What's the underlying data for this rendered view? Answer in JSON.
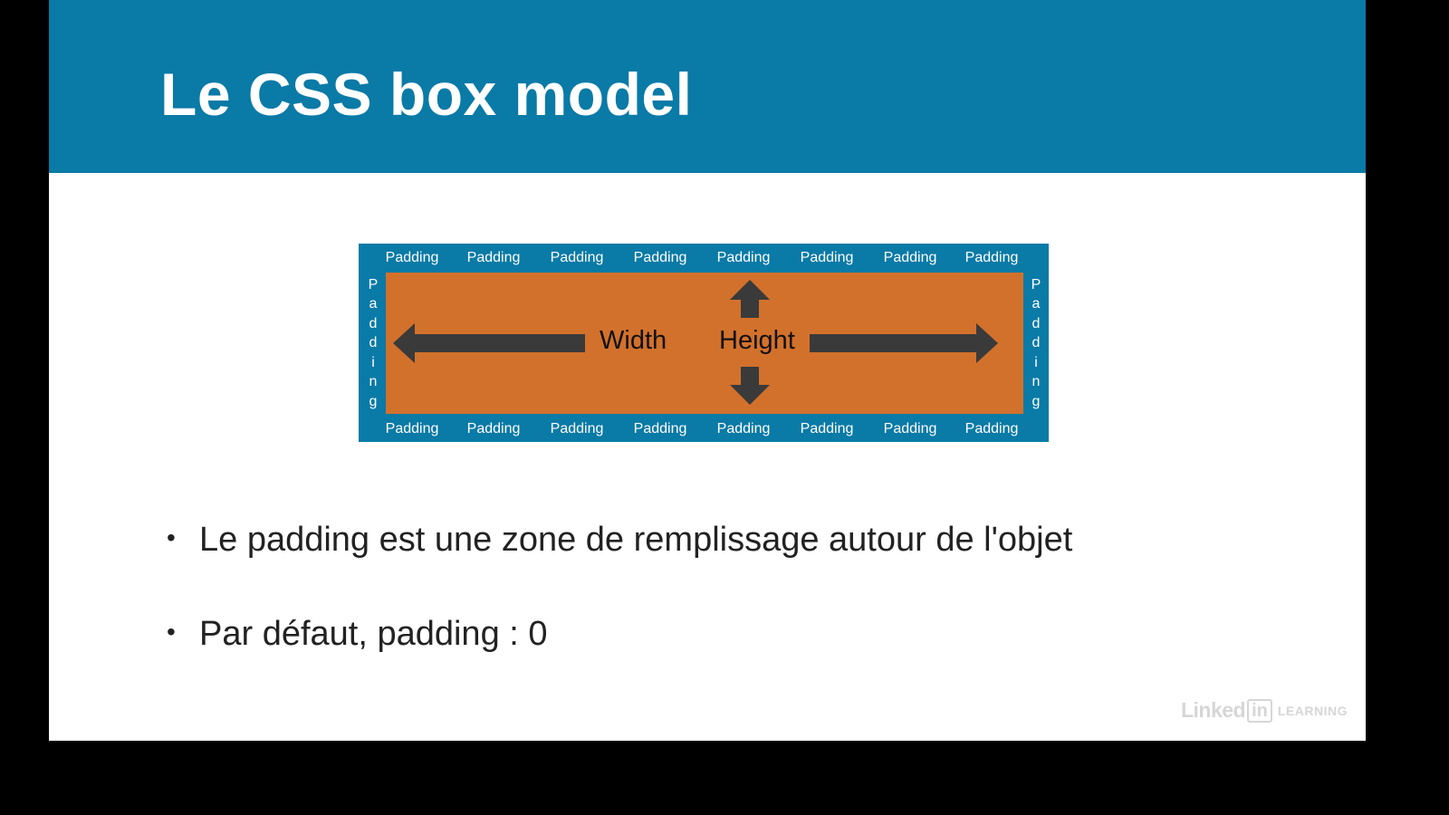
{
  "slide": {
    "title": "Le CSS box model",
    "diagram": {
      "padding_label": "Padding",
      "vertical_padding_letters": [
        "P",
        "a",
        "d",
        "d",
        "i",
        "n",
        "g"
      ],
      "width_label": "Width",
      "height_label": "Height",
      "colors": {
        "padding_area": "#0a7aa6",
        "content_area": "#d2712c",
        "arrows": "#3a3a3a"
      }
    },
    "bullets": [
      "Le padding est une zone de remplissage autour de l'objet",
      "Par défaut, padding : 0"
    ],
    "watermark": {
      "linked": "Linked",
      "in": "in",
      "learning": "LEARNING"
    }
  },
  "colors": {
    "header": "#0a7aa6",
    "background": "#ffffff",
    "frame": "#000000"
  }
}
